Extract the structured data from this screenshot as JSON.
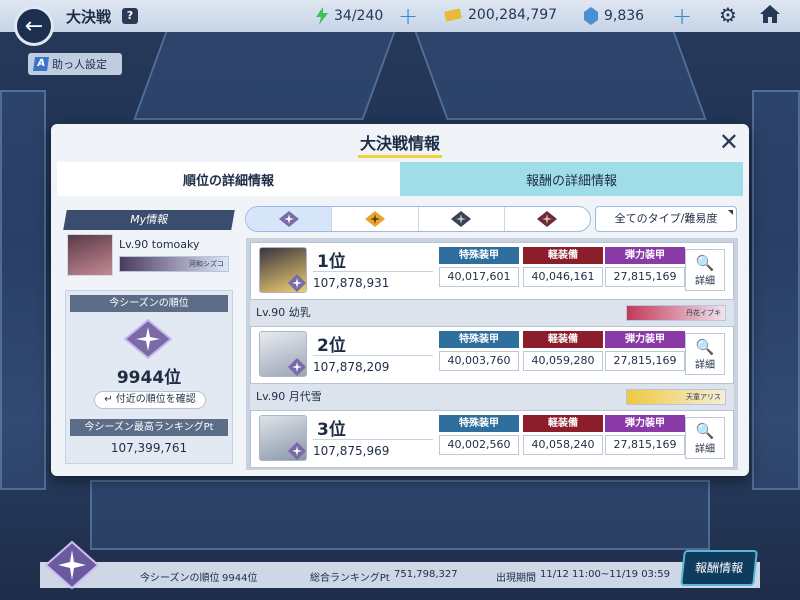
{
  "header": {
    "title": "大決戦",
    "help": "?",
    "stamina": "34/240",
    "credits": "200,284,797",
    "gems": "9,836"
  },
  "helper_button": {
    "badge": "A",
    "label": "助っ人設定"
  },
  "dialog": {
    "title": "大決戦情報",
    "close": "✕",
    "tabs": [
      "順位の詳細情報",
      "報酬の詳細情報"
    ],
    "filter_all": "全てのタイプ/難易度"
  },
  "my_info": {
    "header": "My情報",
    "level_name": "Lv.90 tomoaky",
    "support_name": "河和シズコ",
    "season_rank_label": "今シーズンの順位",
    "season_rank": "9944位",
    "nearby_button": "付近の順位を確認",
    "best_pt_label": "今シーズン最高ランキングPt",
    "best_pt": "107,399,761"
  },
  "ranking": [
    {
      "rank": "1位",
      "points": "107,878,931",
      "attr": [
        "特殊装甲",
        "軽装備",
        "弾力装甲"
      ],
      "vals": [
        "40,017,601",
        "40,046,161",
        "27,815,169"
      ],
      "detail": "詳細",
      "player": "Lv.90 幼乳",
      "support": "丹花イブキ",
      "colors": [
        "#3a3540",
        "#f0d070"
      ]
    },
    {
      "rank": "2位",
      "points": "107,878,209",
      "attr": [
        "特殊装甲",
        "軽装備",
        "弾力装甲"
      ],
      "vals": [
        "40,003,760",
        "40,059,280",
        "27,815,169"
      ],
      "detail": "詳細",
      "player": "Lv.90 月代雪",
      "support": "天童アリス",
      "colors": [
        "#e8ecf2",
        "#9aa4b4"
      ]
    },
    {
      "rank": "3位",
      "points": "107,875,969",
      "attr": [
        "特殊装甲",
        "軽装備",
        "弾力装甲"
      ],
      "vals": [
        "40,002,560",
        "40,058,240",
        "27,815,169"
      ],
      "detail": "詳細",
      "player": "",
      "support": "",
      "colors": [
        "#dde3ea",
        "#8a96a8"
      ]
    }
  ],
  "bottom_bar": {
    "season_rank_label": "今シーズンの順位",
    "season_rank": "9944位",
    "total_pt_label": "総合ランキングPt",
    "total_pt": "751,798,327",
    "period_label": "出現期間",
    "period": "11/12 11:00~11/19 03:59",
    "reward_button": "報酬情報"
  },
  "colors": {
    "accent_blue": "#2e6f9e",
    "accent_red": "#8c1d2a",
    "accent_purple": "#8a3aa6",
    "emblem": "#7a6aa8"
  }
}
